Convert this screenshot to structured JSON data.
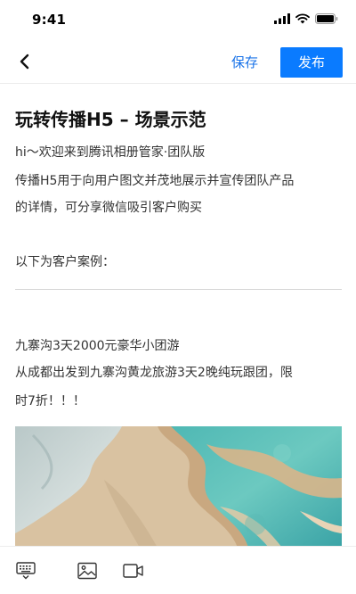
{
  "status_bar": {
    "time": "9:41"
  },
  "nav": {
    "save_label": "保存",
    "publish_label": "发布"
  },
  "article": {
    "title": "玩转传播H5 – 场景示范",
    "intro_line1": "hi～欢迎来到腾讯相册管家·团队版",
    "intro_line2": "传播H5用于向用户图文并茂地展示并宣传团队产品",
    "intro_line3": "的详情，可分享微信吸引客户购买",
    "cases_heading": "以下为客户案例：",
    "case_title": "九寨沟3天2000元豪华小团游",
    "case_desc_line1": "从成都出发到九寨沟黄龙旅游3天2晚纯玩跟团，限",
    "case_desc_line2": "时7折！！！"
  },
  "colors": {
    "accent": "#0a7bff",
    "link": "#1a73e8"
  },
  "icons": [
    "keyboard-icon",
    "image-icon",
    "video-icon"
  ]
}
